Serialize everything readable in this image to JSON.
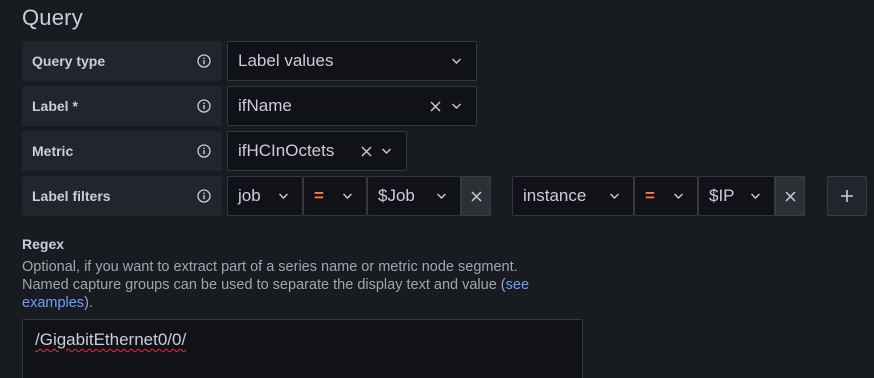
{
  "section": {
    "title": "Query"
  },
  "query_type": {
    "label": "Query type",
    "value": "Label values"
  },
  "label": {
    "label": "Label *",
    "value": "ifName"
  },
  "metric": {
    "label": "Metric",
    "value": "ifHCInOctets"
  },
  "label_filters": {
    "label": "Label filters",
    "filters": [
      {
        "key": "job",
        "operator": "=",
        "value": "$Job"
      },
      {
        "key": "instance",
        "operator": "=",
        "value": "$IP"
      }
    ]
  },
  "regex": {
    "title": "Regex",
    "description_line1": "Optional, if you want to extract part of a series name or metric node segment.",
    "description_line2": "Named capture groups can be used to separate the display text and value (",
    "link_text_1": "see",
    "link_text_2": "examples",
    "description_end": ").",
    "value": "/GigabitEthernet0/0/"
  },
  "colors": {
    "operator": "#ff7a3d",
    "link": "#6e9fff",
    "spellcheck": "#e02f44"
  }
}
